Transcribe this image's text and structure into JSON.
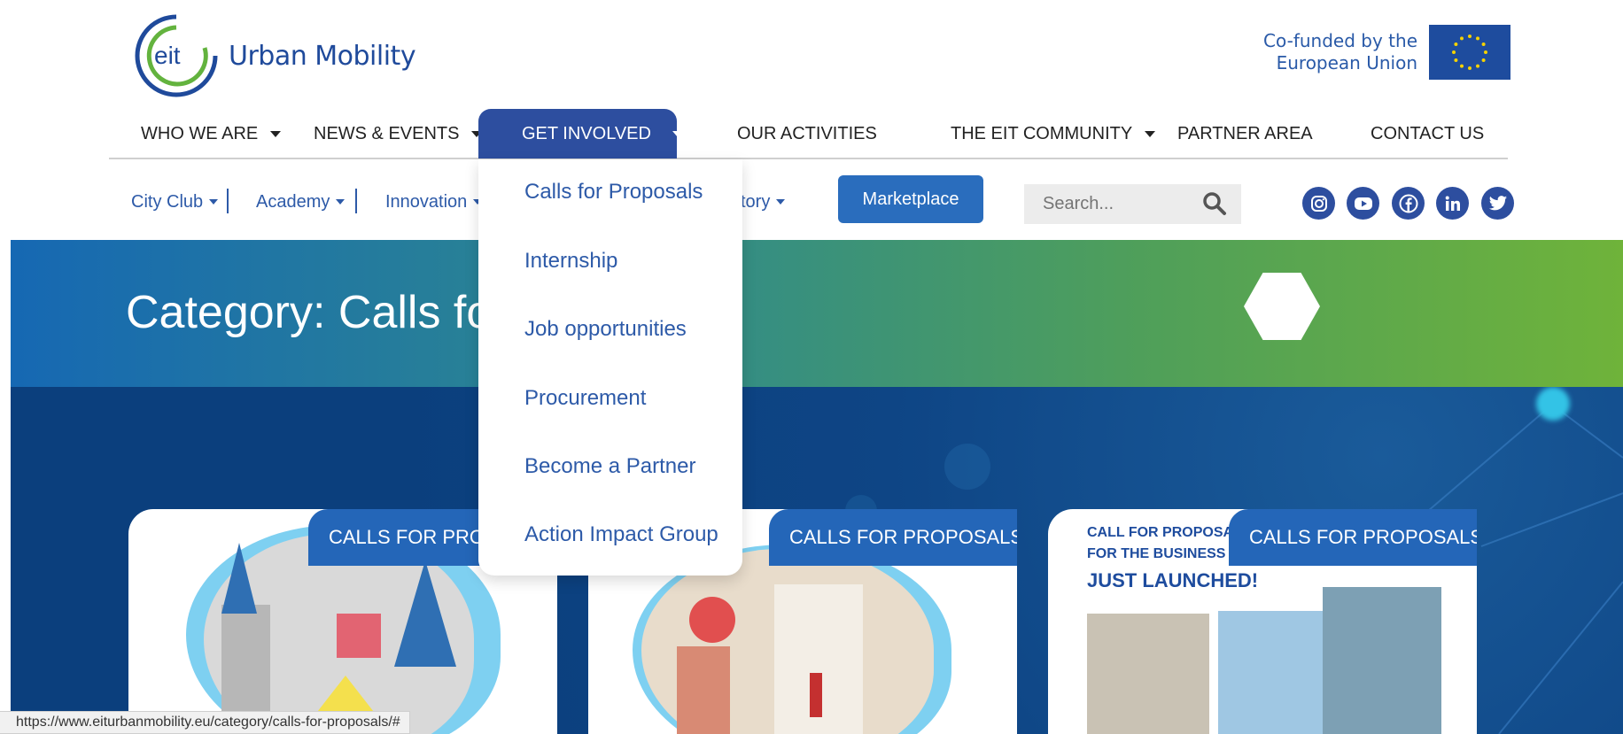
{
  "header": {
    "logo_mark": "eit",
    "logo_text": "Urban Mobility",
    "eu_line1": "Co-funded by the",
    "eu_line2": "European Union"
  },
  "main_nav": [
    {
      "label": "WHO WE ARE",
      "has_caret": true
    },
    {
      "label": "NEWS & EVENTS",
      "has_caret": true
    },
    {
      "label": "GET INVOLVED",
      "has_caret": true,
      "active": true
    },
    {
      "label": "OUR ACTIVITIES",
      "has_caret": false
    },
    {
      "label": "THE EIT COMMUNITY",
      "has_caret": true
    },
    {
      "label": "PARTNER AREA",
      "has_caret": false
    },
    {
      "label": "CONTACT US",
      "has_caret": false
    }
  ],
  "sub_nav": [
    {
      "label": "City Club"
    },
    {
      "label": "Academy"
    },
    {
      "label": "Innovation"
    },
    {
      "label": "ctory"
    }
  ],
  "marketplace_label": "Marketplace",
  "search": {
    "placeholder": "Search..."
  },
  "social_icons": [
    "instagram-icon",
    "youtube-icon",
    "facebook-icon",
    "linkedin-icon",
    "twitter-icon"
  ],
  "dropdown": [
    "Calls for Proposals",
    "Internship",
    "Job opportunities",
    "Procurement",
    "Become a Partner",
    "Action Impact Group"
  ],
  "banner": {
    "title": "Category: Calls for"
  },
  "cards": [
    {
      "tag": "CALLS FOR PROP"
    },
    {
      "tag": "CALLS FOR PROPOSALS"
    },
    {
      "tag": "CALLS FOR PROPOSALS",
      "poster_line1": "CALL FOR PROPOSAL",
      "poster_line2": "FOR THE BUSINESS P",
      "poster_line3": "JUST LAUNCHED!"
    }
  ],
  "status_url": "https://www.eiturbanmobility.eu/category/calls-for-proposals/#",
  "colors": {
    "brand_blue": "#2d4e9f",
    "accent_blue": "#2466b8",
    "eu_blue": "#1e4c9e",
    "green": "#6fb33a"
  }
}
